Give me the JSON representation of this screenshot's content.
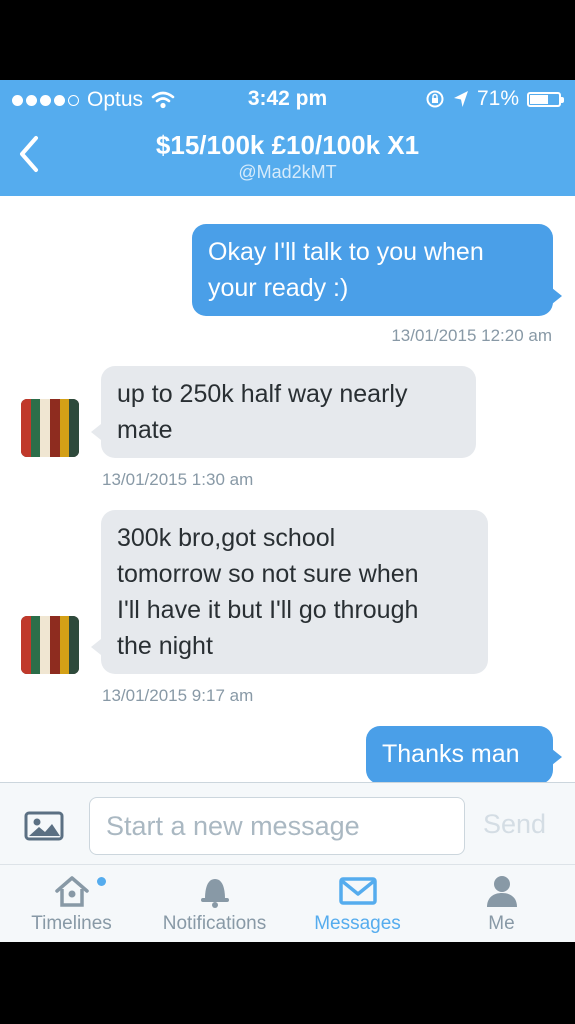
{
  "status_bar": {
    "carrier": "Optus",
    "time": "3:42 pm",
    "battery_text": "71%",
    "battery_level": 0.71,
    "signal_bars_filled": 4,
    "signal_bars_total": 5
  },
  "header": {
    "back_icon": "chevron-left-icon",
    "title": "$15/100k £10/100k X1",
    "handle": "@Mad2kMT"
  },
  "messages": [
    {
      "direction": "out",
      "lines": [
        "Okay I'll talk to you when",
        "your ready :)"
      ],
      "timestamp": "13/01/2015 12:20 am"
    },
    {
      "direction": "in",
      "lines": [
        "up to 250k half way nearly",
        "mate"
      ],
      "timestamp": "13/01/2015 1:30 am"
    },
    {
      "direction": "in",
      "lines": [
        "300k bro,got school",
        "tomorrow so not sure when",
        "I'll have it but I'll go through",
        "the night"
      ],
      "timestamp": "13/01/2015 9:17 am"
    },
    {
      "direction": "out",
      "lines": [
        "Thanks man"
      ]
    }
  ],
  "compose": {
    "photo_icon": "photo-icon",
    "placeholder": "Start a new message",
    "send_label": "Send"
  },
  "tabs": [
    {
      "label": "Timelines",
      "icon": "home-icon",
      "active": false
    },
    {
      "label": "Notifications",
      "icon": "bell-icon",
      "active": false
    },
    {
      "label": "Messages",
      "icon": "envelope-icon",
      "active": true
    },
    {
      "label": "Me",
      "icon": "person-icon",
      "active": false
    }
  ],
  "colors": {
    "brand_blue": "#55acee",
    "outgoing_bubble": "#4a9fe8",
    "incoming_bubble": "#e6e9ed",
    "muted_text": "#8899a6"
  }
}
